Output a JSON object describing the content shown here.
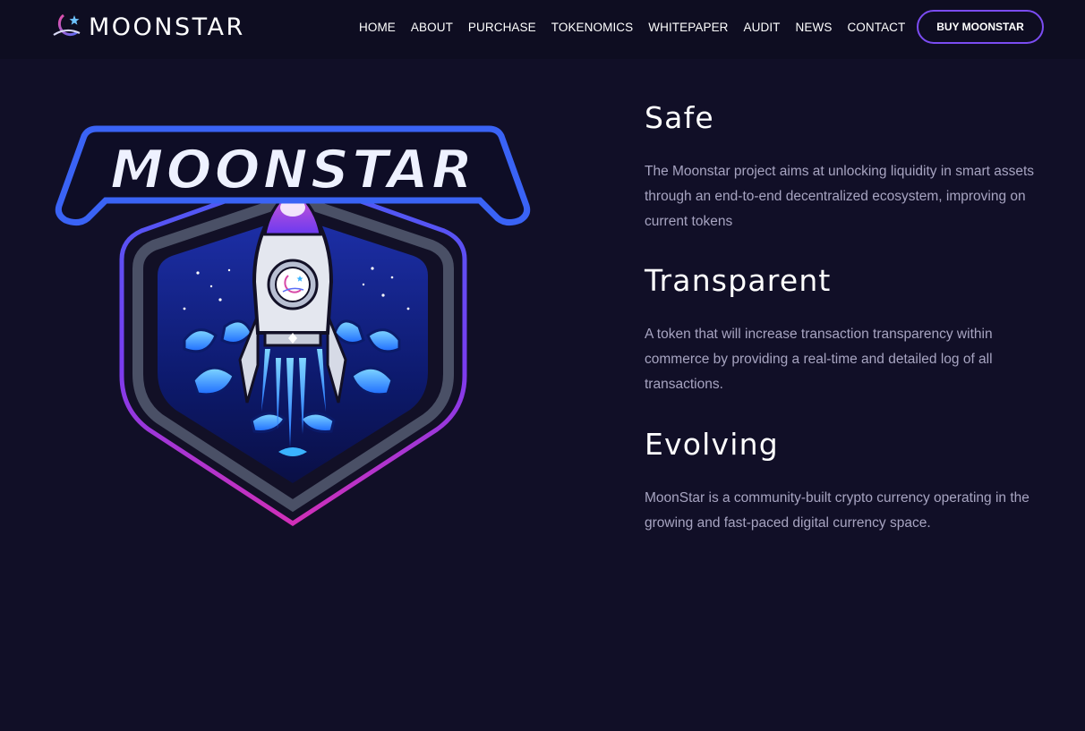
{
  "header": {
    "brand": "MOONSTAR",
    "nav": [
      "HOME",
      "ABOUT",
      "PURCHASE",
      "TOKENOMICS",
      "WHITEPAPER",
      "AUDIT",
      "NEWS",
      "CONTACT"
    ],
    "cta": "BUY MOONSTAR"
  },
  "logo": {
    "wordmark": "MOONSTAR"
  },
  "features": [
    {
      "title": "Safe",
      "text": "The Moonstar project aims at unlocking liquidity in smart assets through an end-to-end decentralized ecosystem, improving on current tokens"
    },
    {
      "title": "Transparent",
      "text": "A token that will increase transaction transparency within commerce by providing a real-time and detailed log of all transactions."
    },
    {
      "title": "Evolving",
      "text": "MoonStar is a community-built crypto currency operating in the growing and fast-paced digital currency space."
    }
  ],
  "colors": {
    "background": "#110f27",
    "header": "#0e0d21",
    "accent_blue": "#3d5af1",
    "accent_magenta": "#c42bc4",
    "accent_purple": "#7b4cf2",
    "body_text": "#a7a4c1"
  },
  "icons": {
    "brand": "moon-star-icon",
    "emblem": "rocket-shield-emblem"
  }
}
